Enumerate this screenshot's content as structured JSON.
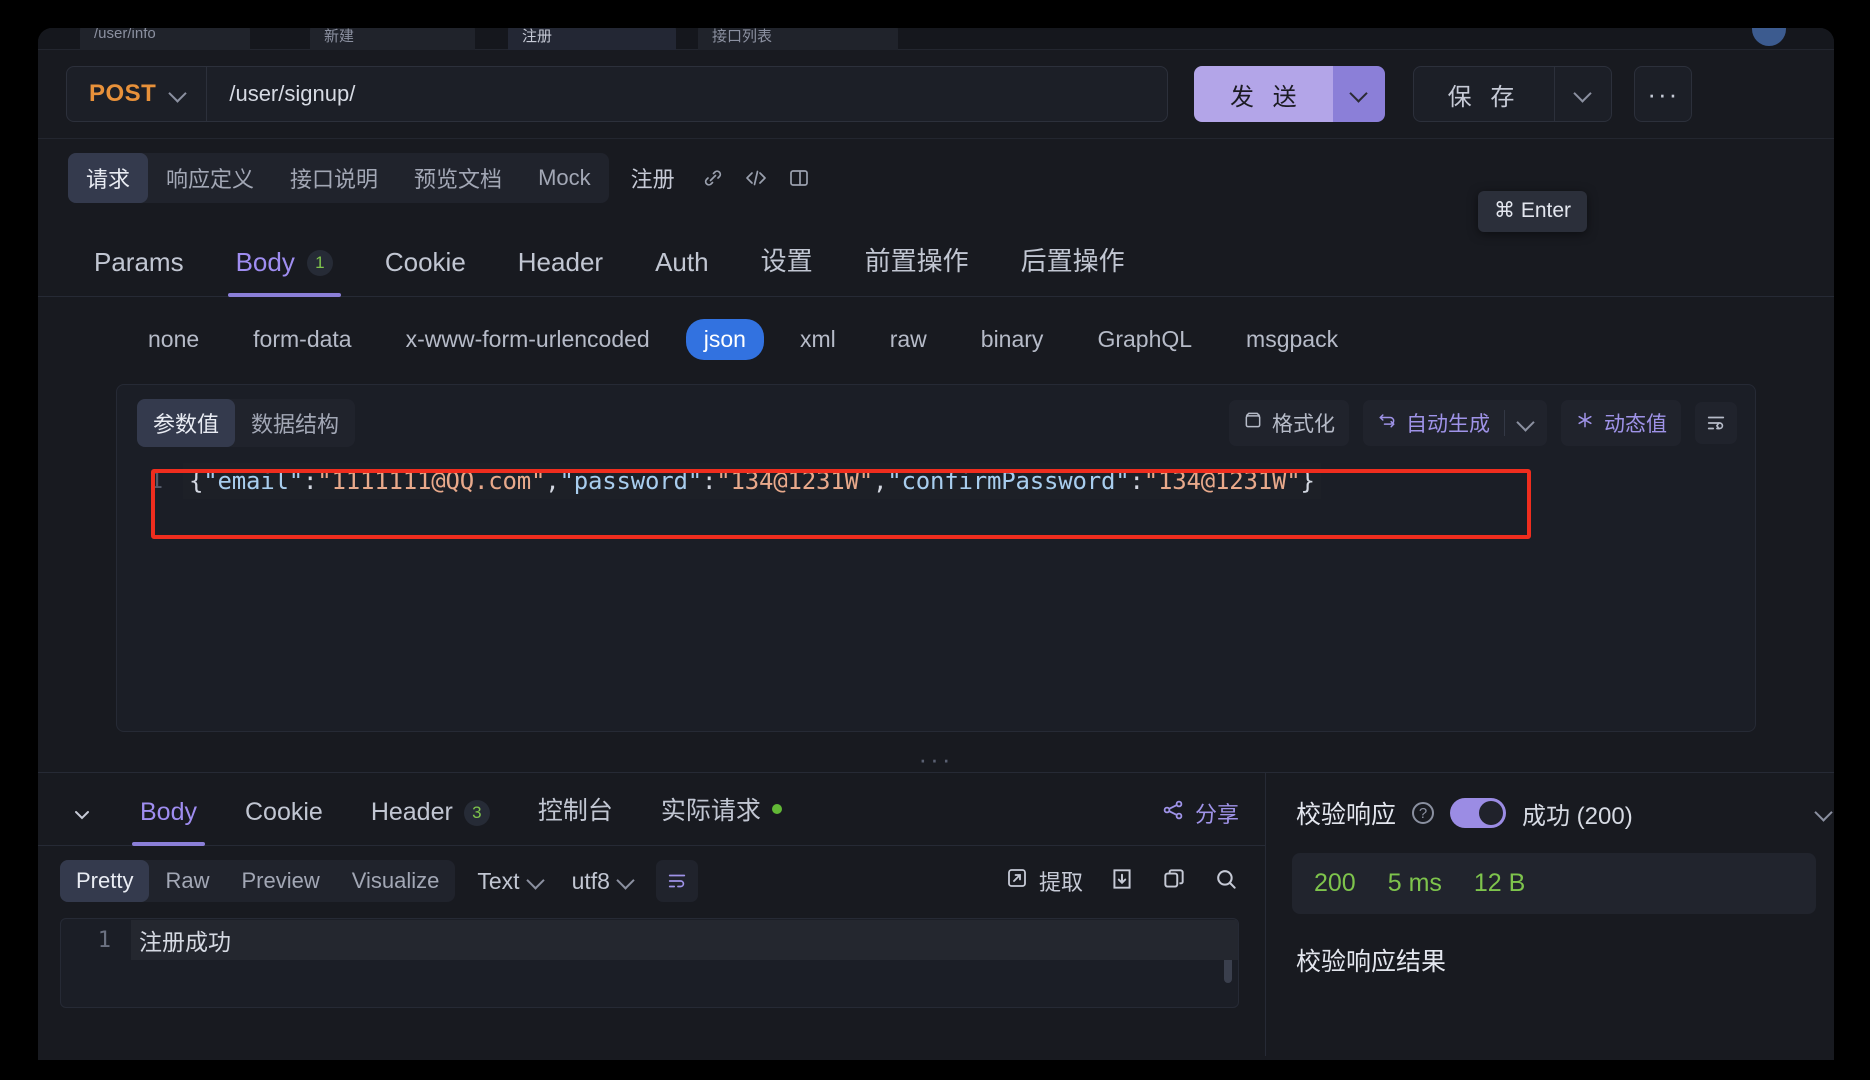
{
  "window": {
    "top_tabs": [
      {
        "label": "/user/info",
        "selected": false
      },
      {
        "label": "新建",
        "selected": false
      },
      {
        "label": "注册",
        "selected": true
      },
      {
        "label": "接口列表",
        "selected": false
      }
    ]
  },
  "urlbar": {
    "method": "POST",
    "url": "/user/signup/",
    "send_label": "发 送",
    "save_label": "保 存",
    "more_label": "···",
    "tooltip": "⌘ Enter"
  },
  "subtabs": {
    "items": [
      {
        "label": "请求",
        "active": true
      },
      {
        "label": "响应定义",
        "active": false
      },
      {
        "label": "接口说明",
        "active": false
      },
      {
        "label": "预览文档",
        "active": false
      },
      {
        "label": "Mock",
        "active": false
      }
    ],
    "plain": "注册",
    "icons": [
      "link-icon",
      "code-icon",
      "panel-icon"
    ]
  },
  "main_tabs": [
    {
      "label": "Params",
      "active": false,
      "badge": ""
    },
    {
      "label": "Body",
      "active": true,
      "badge": "1"
    },
    {
      "label": "Cookie",
      "active": false,
      "badge": ""
    },
    {
      "label": "Header",
      "active": false,
      "badge": ""
    },
    {
      "label": "Auth",
      "active": false,
      "badge": ""
    },
    {
      "label": "设置",
      "active": false,
      "badge": ""
    },
    {
      "label": "前置操作",
      "active": false,
      "badge": ""
    },
    {
      "label": "后置操作",
      "active": false,
      "badge": ""
    }
  ],
  "body_types": [
    {
      "label": "none",
      "active": false
    },
    {
      "label": "form-data",
      "active": false
    },
    {
      "label": "x-www-form-urlencoded",
      "active": false
    },
    {
      "label": "json",
      "active": true
    },
    {
      "label": "xml",
      "active": false
    },
    {
      "label": "raw",
      "active": false
    },
    {
      "label": "binary",
      "active": false
    },
    {
      "label": "GraphQL",
      "active": false
    },
    {
      "label": "msgpack",
      "active": false
    }
  ],
  "editor": {
    "segments": [
      {
        "label": "参数值",
        "active": true
      },
      {
        "label": "数据结构",
        "active": false
      }
    ],
    "tools": {
      "format": "格式化",
      "autogen": "自动生成",
      "dynamic": "动态值",
      "wrap_icon": "wrap-lines-icon"
    },
    "line_number": "1",
    "code_tokens": [
      {
        "t": "punc",
        "v": "{"
      },
      {
        "t": "key",
        "v": "\"email\""
      },
      {
        "t": "punc",
        "v": ":"
      },
      {
        "t": "str",
        "v": "\"1111111@QQ.com\""
      },
      {
        "t": "punc",
        "v": ","
      },
      {
        "t": "key",
        "v": "\"password\""
      },
      {
        "t": "punc",
        "v": ":"
      },
      {
        "t": "str",
        "v": "\"134@1231W\""
      },
      {
        "t": "punc",
        "v": ","
      },
      {
        "t": "key",
        "v": "\"confirmPassword\""
      },
      {
        "t": "punc",
        "v": ":"
      },
      {
        "t": "str",
        "v": "\"134@1231W\""
      },
      {
        "t": "punc",
        "v": "}"
      }
    ],
    "highlight_color": "#ef2d1e"
  },
  "splitter": "···",
  "response": {
    "tabs": [
      {
        "label": "Body",
        "active": true,
        "badge": "",
        "dot": false
      },
      {
        "label": "Cookie",
        "active": false,
        "badge": "",
        "dot": false
      },
      {
        "label": "Header",
        "active": false,
        "badge": "3",
        "dot": false
      },
      {
        "label": "控制台",
        "active": false,
        "badge": "",
        "dot": false
      },
      {
        "label": "实际请求",
        "active": false,
        "badge": "",
        "dot": true
      }
    ],
    "share_label": "分享",
    "formats": [
      {
        "label": "Pretty",
        "active": true
      },
      {
        "label": "Raw",
        "active": false
      },
      {
        "label": "Preview",
        "active": false
      },
      {
        "label": "Visualize",
        "active": false
      }
    ],
    "type_select": "Text",
    "encoding_select": "utf8",
    "extract_label": "提取",
    "icons": [
      "wrap-lines-icon",
      "extract-icon",
      "download-icon",
      "copy-icon",
      "search-icon"
    ],
    "body_line_number": "1",
    "body_text": "注册成功"
  },
  "verify": {
    "title": "校验响应",
    "help_icon": "?",
    "toggle_on": true,
    "status": "成功 (200)",
    "metrics": [
      "200",
      "5 ms",
      "12 B"
    ],
    "result_title": "校验响应结果"
  }
}
